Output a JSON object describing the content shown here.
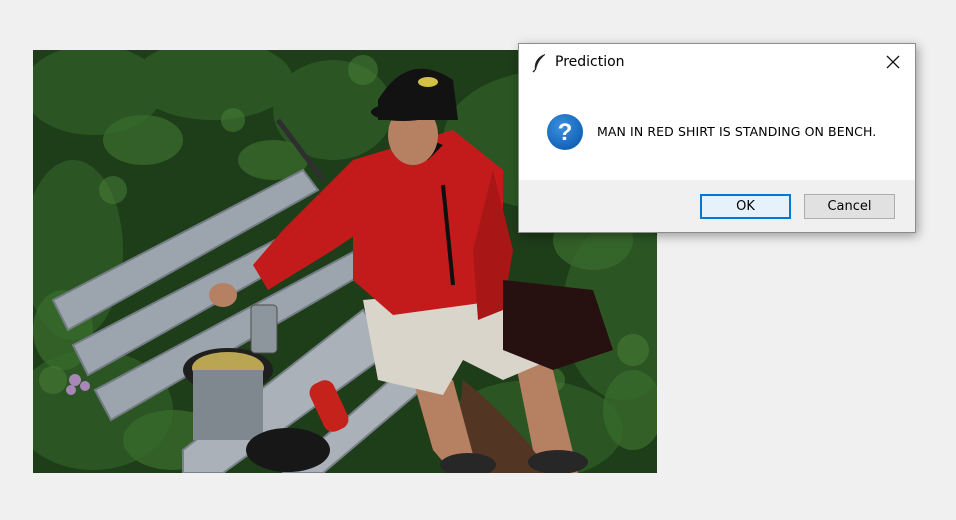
{
  "photo": {
    "description_icon": "photo-image"
  },
  "dialog": {
    "title": "Prediction",
    "title_icon": "feather-icon",
    "message": "MAN IN RED SHIRT IS STANDING ON BENCH.",
    "message_icon": "question-icon",
    "buttons": {
      "ok": "OK",
      "cancel": "Cancel"
    }
  },
  "colors": {
    "page_bg": "#f0f0f0",
    "dialog_bg": "#ffffff",
    "footer_bg": "#f0f0f0",
    "question_icon": "#1a6fc4",
    "ok_border": "#0078d7"
  }
}
